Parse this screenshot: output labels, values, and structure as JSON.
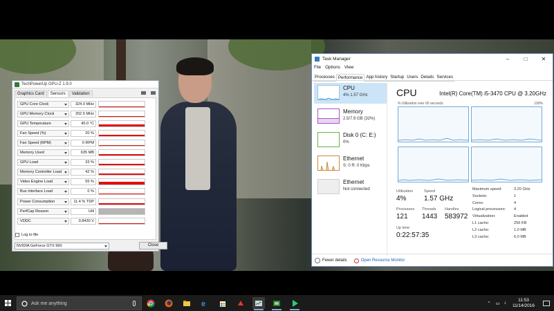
{
  "gpuz": {
    "title": "TechPowerUp GPU-Z 1.9.0",
    "tabs": [
      "Graphics Card",
      "Sensors",
      "Validation"
    ],
    "active_tab": "Sensors",
    "sensors": [
      {
        "label": "GPU Core Clock",
        "value": "324.0 MHz",
        "level": 0.12
      },
      {
        "label": "GPU Memory Clock",
        "value": "202.5 MHz",
        "level": 0.1
      },
      {
        "label": "GPU Temperature",
        "value": "45.0 °C",
        "level": 0.35
      },
      {
        "label": "Fan Speed (%)",
        "value": "20 %",
        "level": 0.25
      },
      {
        "label": "Fan Speed (RPM)",
        "value": "0 RPM",
        "level": 0.08
      },
      {
        "label": "Memory Used",
        "value": "635 MB",
        "level": 0.2
      },
      {
        "label": "GPU Load",
        "value": "33 %",
        "level": 0.2
      },
      {
        "label": "Memory Controller Load",
        "value": "42 %",
        "level": 0.3
      },
      {
        "label": "Video Engine Load",
        "value": "55 %",
        "level": 0.45
      },
      {
        "label": "Bus Interface Load",
        "value": "0 %",
        "level": 0.0
      },
      {
        "label": "Power Consumption",
        "value": "11.4 % TDP",
        "level": 0.2
      },
      {
        "label": "PerfCap Reason",
        "value": "Util",
        "level": 1.0,
        "gray": true
      },
      {
        "label": "VDDC",
        "value": "0.8430 V",
        "level": 0.15
      }
    ],
    "log_to_file_label": "Log to file",
    "gpu_select": "NVIDIA GeForce GTX 960",
    "close_label": "Close"
  },
  "taskmanager": {
    "title": "Task Manager",
    "menu": [
      "File",
      "Options",
      "View"
    ],
    "tabs": [
      "Processes",
      "Performance",
      "App history",
      "Startup",
      "Users",
      "Details",
      "Services"
    ],
    "active_tab": "Performance",
    "resources": [
      {
        "name": "CPU",
        "sub": "4% 1.57 GHz"
      },
      {
        "name": "Memory",
        "sub": "2.5/7.9 GB (32%)"
      },
      {
        "name": "Disk 0 (C: E:)",
        "sub": "0%"
      },
      {
        "name": "Ethernet",
        "sub": "S: 0 R: 0 Kbps"
      },
      {
        "name": "Ethernet",
        "sub": "Not connected"
      }
    ],
    "cpu_title": "CPU",
    "cpu_name": "Intel(R) Core(TM) i5-3470 CPU @ 3.20GHz",
    "util_caption": "% Utilization over 60 seconds",
    "util_max": "100%",
    "stats": {
      "utilization_label": "Utilization",
      "utilization": "4%",
      "speed_label": "Speed",
      "speed": "1.57 GHz",
      "processes_label": "Processes",
      "processes": "121",
      "threads_label": "Threads",
      "threads": "1443",
      "handles_label": "Handles",
      "handles": "583972",
      "uptime_label": "Up time",
      "uptime": "0:22:57:35"
    },
    "specs": [
      {
        "k": "Maximum speed:",
        "v": "3.20 GHz"
      },
      {
        "k": "Sockets:",
        "v": "1"
      },
      {
        "k": "Cores:",
        "v": "4"
      },
      {
        "k": "Logical processors:",
        "v": "4"
      },
      {
        "k": "Virtualization:",
        "v": "Enabled"
      },
      {
        "k": "L1 cache:",
        "v": "256 KB"
      },
      {
        "k": "L2 cache:",
        "v": "1.0 MB"
      },
      {
        "k": "L3 cache:",
        "v": "6.0 MB"
      }
    ],
    "fewer_details": "Fewer details",
    "open_resource_monitor": "Open Resource Monitor"
  },
  "taskbar": {
    "search_placeholder": "Ask me anything",
    "time": "11:53",
    "date": "11/14/2016",
    "apps": [
      "chrome-icon",
      "firefox-icon",
      "file-explorer-icon",
      "edge-icon",
      "store-icon",
      "red-app-icon",
      "task-manager-icon",
      "gpuz-icon",
      "media-player-icon"
    ]
  }
}
